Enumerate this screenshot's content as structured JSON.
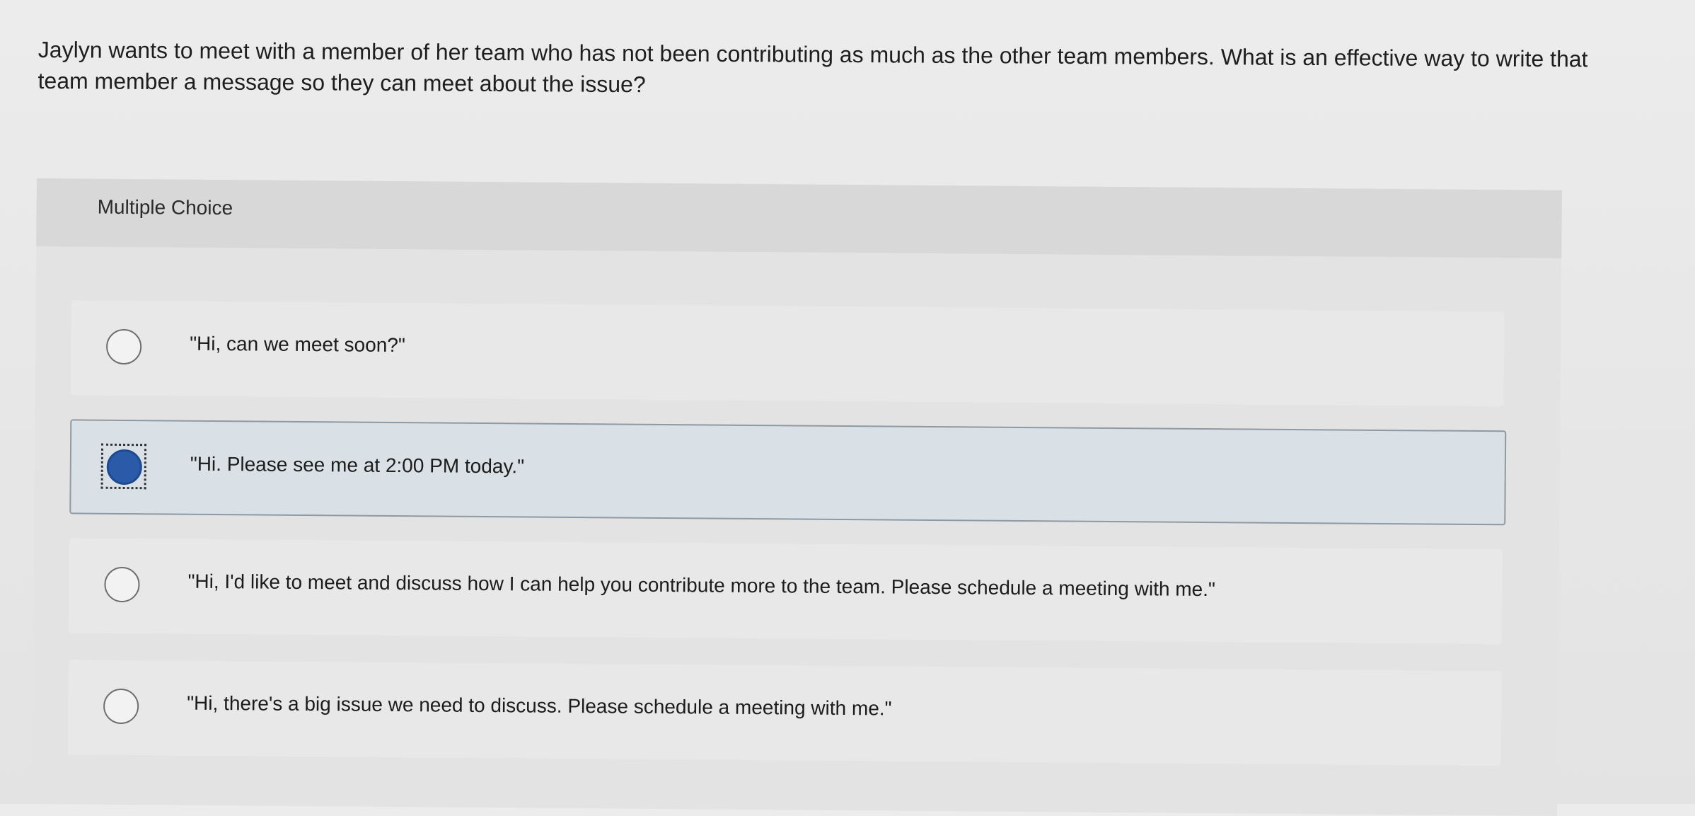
{
  "question": {
    "text": "Jaylyn wants to meet with a member of her team who has not been contributing as much as the other team members. What is an effective way to write that team member a message so they can meet about the issue?"
  },
  "multiple_choice": {
    "title": "Multiple Choice",
    "options": [
      {
        "label": "\"Hi, can we meet soon?\"",
        "selected": false
      },
      {
        "label": "\"Hi. Please see me at 2:00 PM today.\"",
        "selected": true
      },
      {
        "label": "\"Hi, I'd like to meet and discuss how I can help you contribute more to the team. Please schedule a meeting with me.\"",
        "selected": false
      },
      {
        "label": "\"Hi, there's a big issue we need to discuss. Please schedule a meeting with me.\"",
        "selected": false
      }
    ]
  },
  "colors": {
    "selected_radio": "#2a5aa8",
    "selected_background": "#d9e1e6"
  }
}
